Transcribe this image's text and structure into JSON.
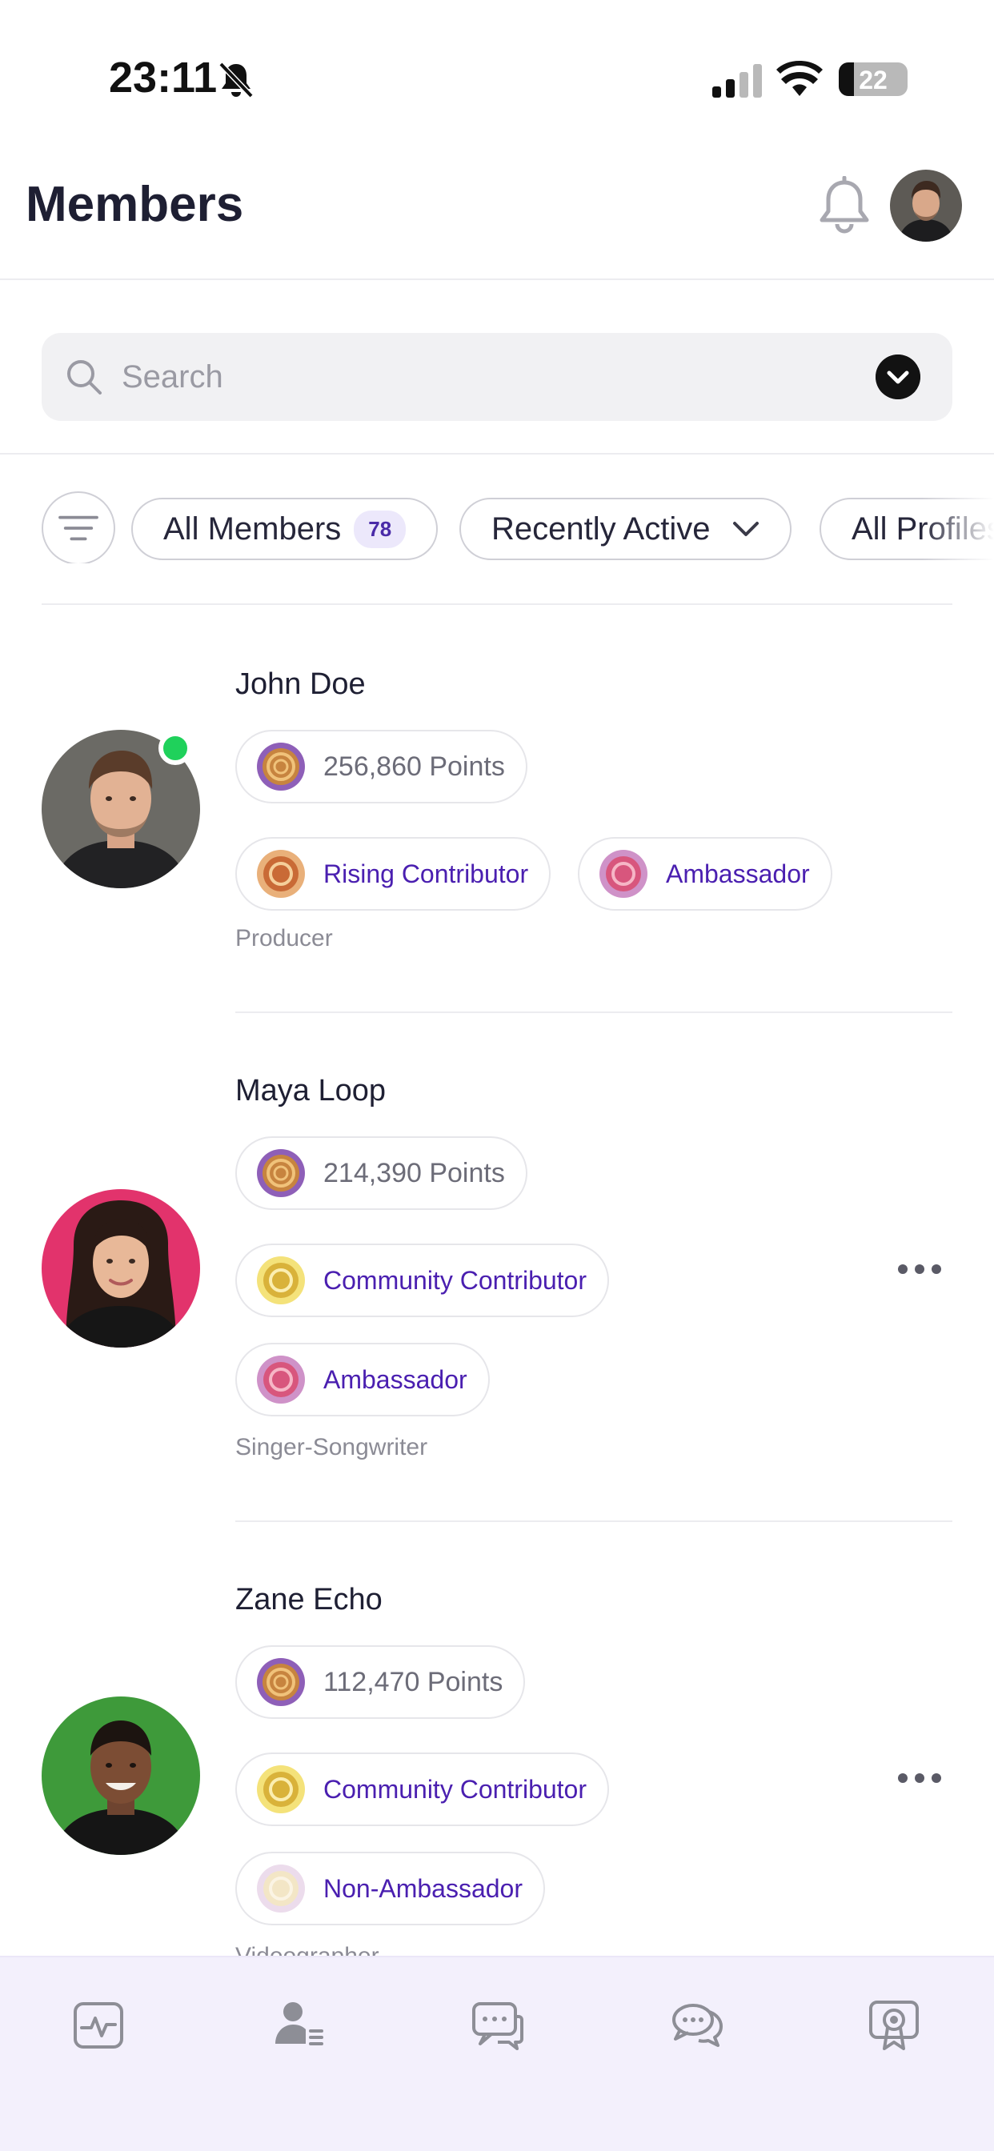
{
  "status_bar": {
    "time": "23:11",
    "battery": "22"
  },
  "header": {
    "title": "Members"
  },
  "search": {
    "placeholder": "Search"
  },
  "filters": {
    "all_members_label": "All Members",
    "all_members_count": "78",
    "sort_label": "Recently Active",
    "profiles_label": "All Profiles"
  },
  "members": [
    {
      "name": "John Doe",
      "points": "256,860 Points",
      "badges": [
        "Rising Contributor",
        "Ambassador"
      ],
      "role": "Producer",
      "online": true
    },
    {
      "name": "Maya Loop",
      "points": "214,390 Points",
      "badges": [
        "Community Contributor",
        "Ambassador"
      ],
      "role": "Singer-Songwriter",
      "online": false
    },
    {
      "name": "Zane Echo",
      "points": "112,470 Points",
      "badges": [
        "Community Contributor",
        "Non-Ambassador"
      ],
      "role": "Videographer",
      "online": false
    }
  ],
  "icons": {
    "nav": [
      "activity-icon",
      "members-icon",
      "chat-icon",
      "discussions-icon",
      "achievements-icon"
    ]
  },
  "colors": {
    "accent": "#4a1fb0",
    "online": "#1fd15b",
    "nav_background": "#f3f0fc"
  }
}
